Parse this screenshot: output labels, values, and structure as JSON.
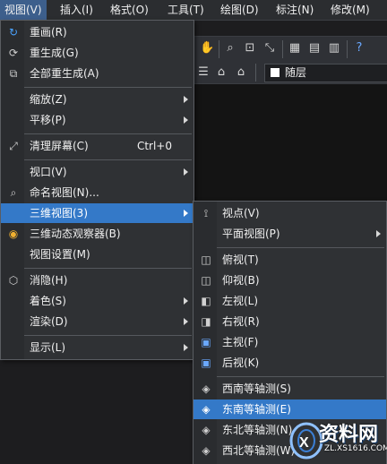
{
  "menubar": {
    "items": [
      {
        "label": "视图(V)",
        "active": true
      },
      {
        "label": "插入(I)"
      },
      {
        "label": "格式(O)"
      },
      {
        "label": "工具(T)"
      },
      {
        "label": "绘图(D)"
      },
      {
        "label": "标注(N)"
      },
      {
        "label": "修改(M)"
      }
    ]
  },
  "toolbar": {
    "layer_name": "随层",
    "icons": [
      "hand-icon",
      "zoom-realtime-icon",
      "zoom-window-icon",
      "zoom-previous-icon",
      "properties-icon",
      "design-center-icon",
      "tool-palette-icon",
      "help-icon"
    ]
  },
  "view_menu": {
    "items": [
      {
        "label": "重画(R)",
        "icon": "redraw-icon"
      },
      {
        "label": "重生成(G)",
        "icon": "regen-icon"
      },
      {
        "label": "全部重生成(A)",
        "icon": "regen-all-icon"
      },
      {
        "label": "缩放(Z)",
        "submenu": true
      },
      {
        "label": "平移(P)",
        "submenu": true
      },
      {
        "label": "清理屏幕(C)",
        "icon": "clean-screen-icon",
        "shortcut": "Ctrl+0"
      },
      {
        "label": "视口(V)",
        "submenu": true
      },
      {
        "label": "命名视图(N)...",
        "icon": "named-view-icon"
      },
      {
        "label": "三维视图(3)",
        "submenu": true,
        "selected": true
      },
      {
        "label": "三维动态观察器(B)",
        "icon": "orbit-icon"
      },
      {
        "label": "视图设置(M)"
      },
      {
        "label": "消隐(H)",
        "icon": "hide-icon"
      },
      {
        "label": "着色(S)",
        "submenu": true
      },
      {
        "label": "渲染(D)",
        "submenu": true
      },
      {
        "label": "显示(L)",
        "submenu": true
      }
    ]
  },
  "view3d_menu": {
    "items": [
      {
        "label": "视点(V)",
        "icon": "viewpoint-icon"
      },
      {
        "label": "平面视图(P)",
        "submenu": true
      },
      {
        "label": "俯视(T)",
        "icon": "top-view-icon"
      },
      {
        "label": "仰视(B)",
        "icon": "bottom-view-icon"
      },
      {
        "label": "左视(L)",
        "icon": "left-view-icon"
      },
      {
        "label": "右视(R)",
        "icon": "right-view-icon"
      },
      {
        "label": "主视(F)",
        "icon": "front-view-icon"
      },
      {
        "label": "后视(K)",
        "icon": "back-view-icon"
      },
      {
        "label": "西南等轴测(S)",
        "icon": "sw-iso-icon"
      },
      {
        "label": "东南等轴测(E)",
        "icon": "se-iso-icon",
        "selected": true
      },
      {
        "label": "东北等轴测(N)",
        "icon": "ne-iso-icon"
      },
      {
        "label": "西北等轴测(W)",
        "icon": "nw-iso-icon"
      }
    ]
  },
  "watermark": {
    "text": "资料网",
    "url": "ZL.XS1616.COM"
  },
  "colors": {
    "menu_bg": "#2f3134",
    "highlight": "#3479c8",
    "menubar_active": "#3d5f8c"
  }
}
